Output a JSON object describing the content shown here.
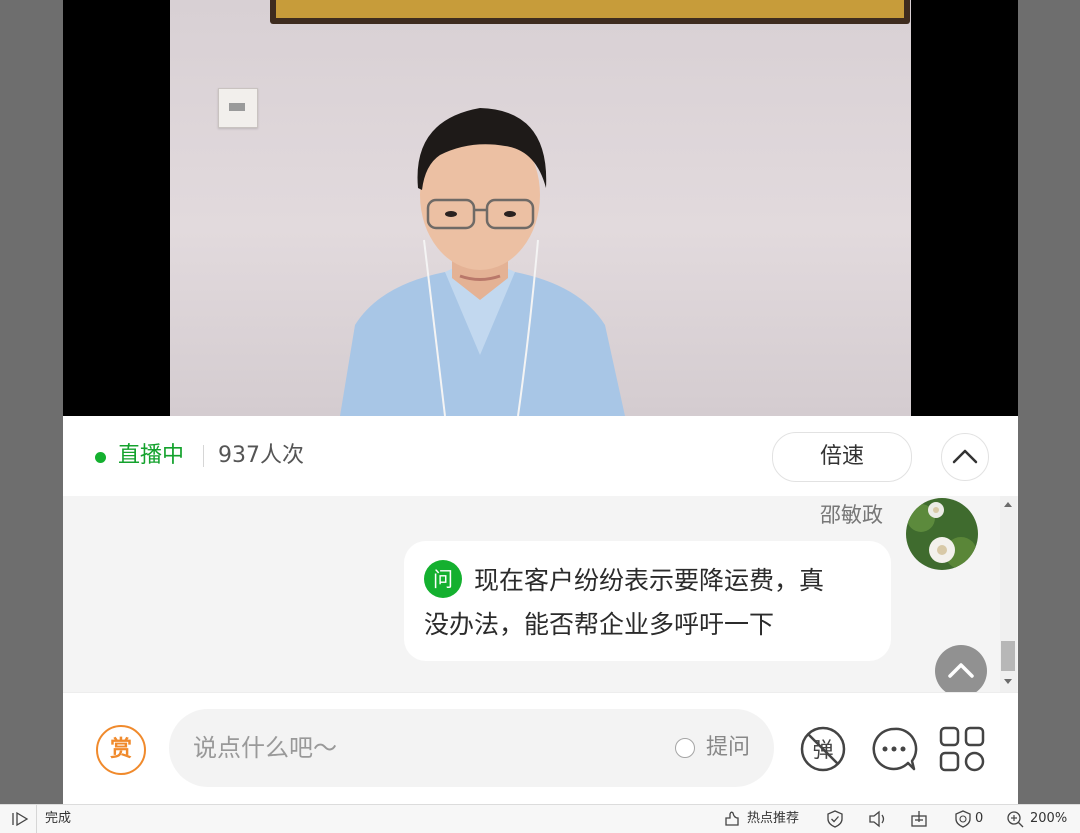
{
  "live": {
    "status_label": "直播中",
    "viewer_count": "937人次",
    "speed_button": "倍速"
  },
  "chat": {
    "sender_name": "邵敏政",
    "question_tag": "问",
    "message_line1": "现在客户纷纷表示要降运费，真",
    "message_line2": "没办法，能否帮企业多呼吁一下"
  },
  "input_bar": {
    "reward_label": "赏",
    "placeholder": "说点什么吧～",
    "ask_label": "提问",
    "danmu_label": "弹"
  },
  "statusbar": {
    "status_text": "完成",
    "hot_recommend": "热点推荐",
    "ad_block_count": "0",
    "zoom": "200%"
  },
  "colors": {
    "accent_green": "#14b02f",
    "reward_orange": "#f08a2c"
  }
}
